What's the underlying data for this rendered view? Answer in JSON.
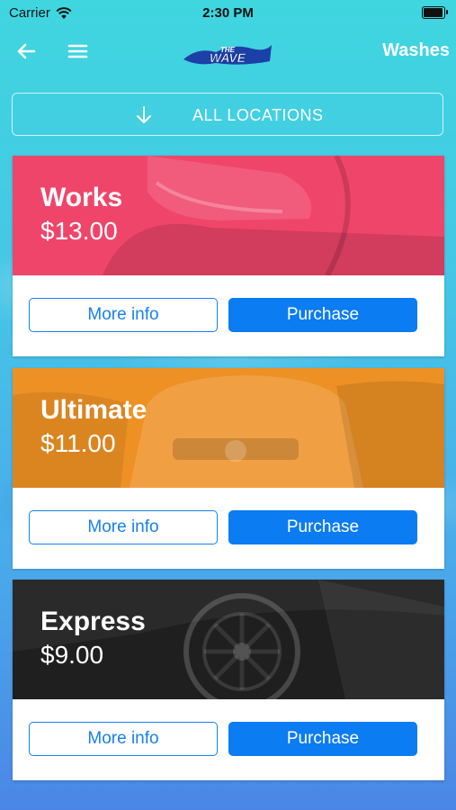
{
  "status_bar": {
    "carrier": "Carrier",
    "time": "2:30 PM",
    "battery_level": 0.95
  },
  "nav": {
    "title": "Washes",
    "logo_text": "THE WAVE"
  },
  "location_button": {
    "label": "ALL LOCATIONS"
  },
  "cards": [
    {
      "name": "Works",
      "price": "$13.00",
      "color": "#f0456a",
      "more_info_label": "More info",
      "purchase_label": "Purchase"
    },
    {
      "name": "Ultimate",
      "price": "$11.00",
      "color": "#ee9124",
      "more_info_label": "More info",
      "purchase_label": "Purchase"
    },
    {
      "name": "Express",
      "price": "$9.00",
      "color": "#1f1f1f",
      "more_info_label": "More info",
      "purchase_label": "Purchase"
    }
  ],
  "colors": {
    "accent": "#0b7cf2",
    "bg_top": "#3fd6df",
    "bg_bottom": "#4b86e6"
  }
}
